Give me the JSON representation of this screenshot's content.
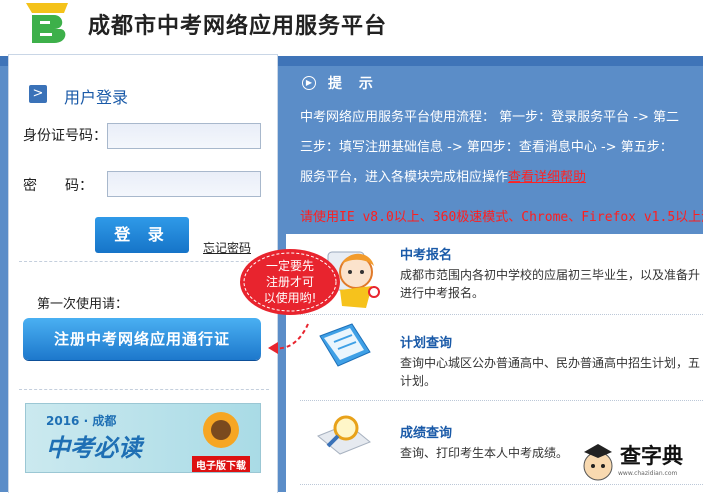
{
  "header": {
    "site_title": "成都市中考网络应用服务平台"
  },
  "login": {
    "title": "用户登录",
    "id_label": "身份证号码：",
    "password_label": "密　　码：",
    "login_button": "登 录",
    "forgot_link": "忘记密码"
  },
  "register": {
    "first_use_label": "第一次使用请：",
    "register_button": "注册中考网络应用通行证"
  },
  "banner": {
    "year": "2016 · 成都",
    "text": "中考必读",
    "badge": "电子版下载"
  },
  "bubble": {
    "line1": "一定要先",
    "line2": "注册才可",
    "line3": "以使用哟!"
  },
  "tips": {
    "title": "提 示",
    "line1": "中考网络应用服务平台使用流程： 第一步：登录服务平台 -> 第二",
    "line2": "三步：填写注册基础信息 -> 第四步：查看消息中心 -> 第五步：",
    "line3_prefix": "服务平台，进入各模块完成相应操作",
    "help_link": "查看详细帮助",
    "warning": "请使用IE v8.0以上、360极速模式、Chrome、Firefox v1.5以上浏"
  },
  "modules": [
    {
      "title": "中考报名",
      "desc1": "成都市范围内各初中学校的应届初三毕业生，以及准备升",
      "desc2": "进行中考报名。"
    },
    {
      "title": "计划查询",
      "desc1": "查询中心城区公办普通高中、民办普通高中招生计划，五",
      "desc2": "计划。"
    },
    {
      "title": "成绩查询",
      "desc1": "查询、打印考生本人中考成绩。",
      "desc2": ""
    }
  ],
  "watermark": {
    "text": "查字典",
    "sub": "www.chazidian.com"
  },
  "colors": {
    "brand_blue": "#5b8dc8",
    "link_blue": "#1a5aa8",
    "warning_red": "#ff1e1e"
  }
}
